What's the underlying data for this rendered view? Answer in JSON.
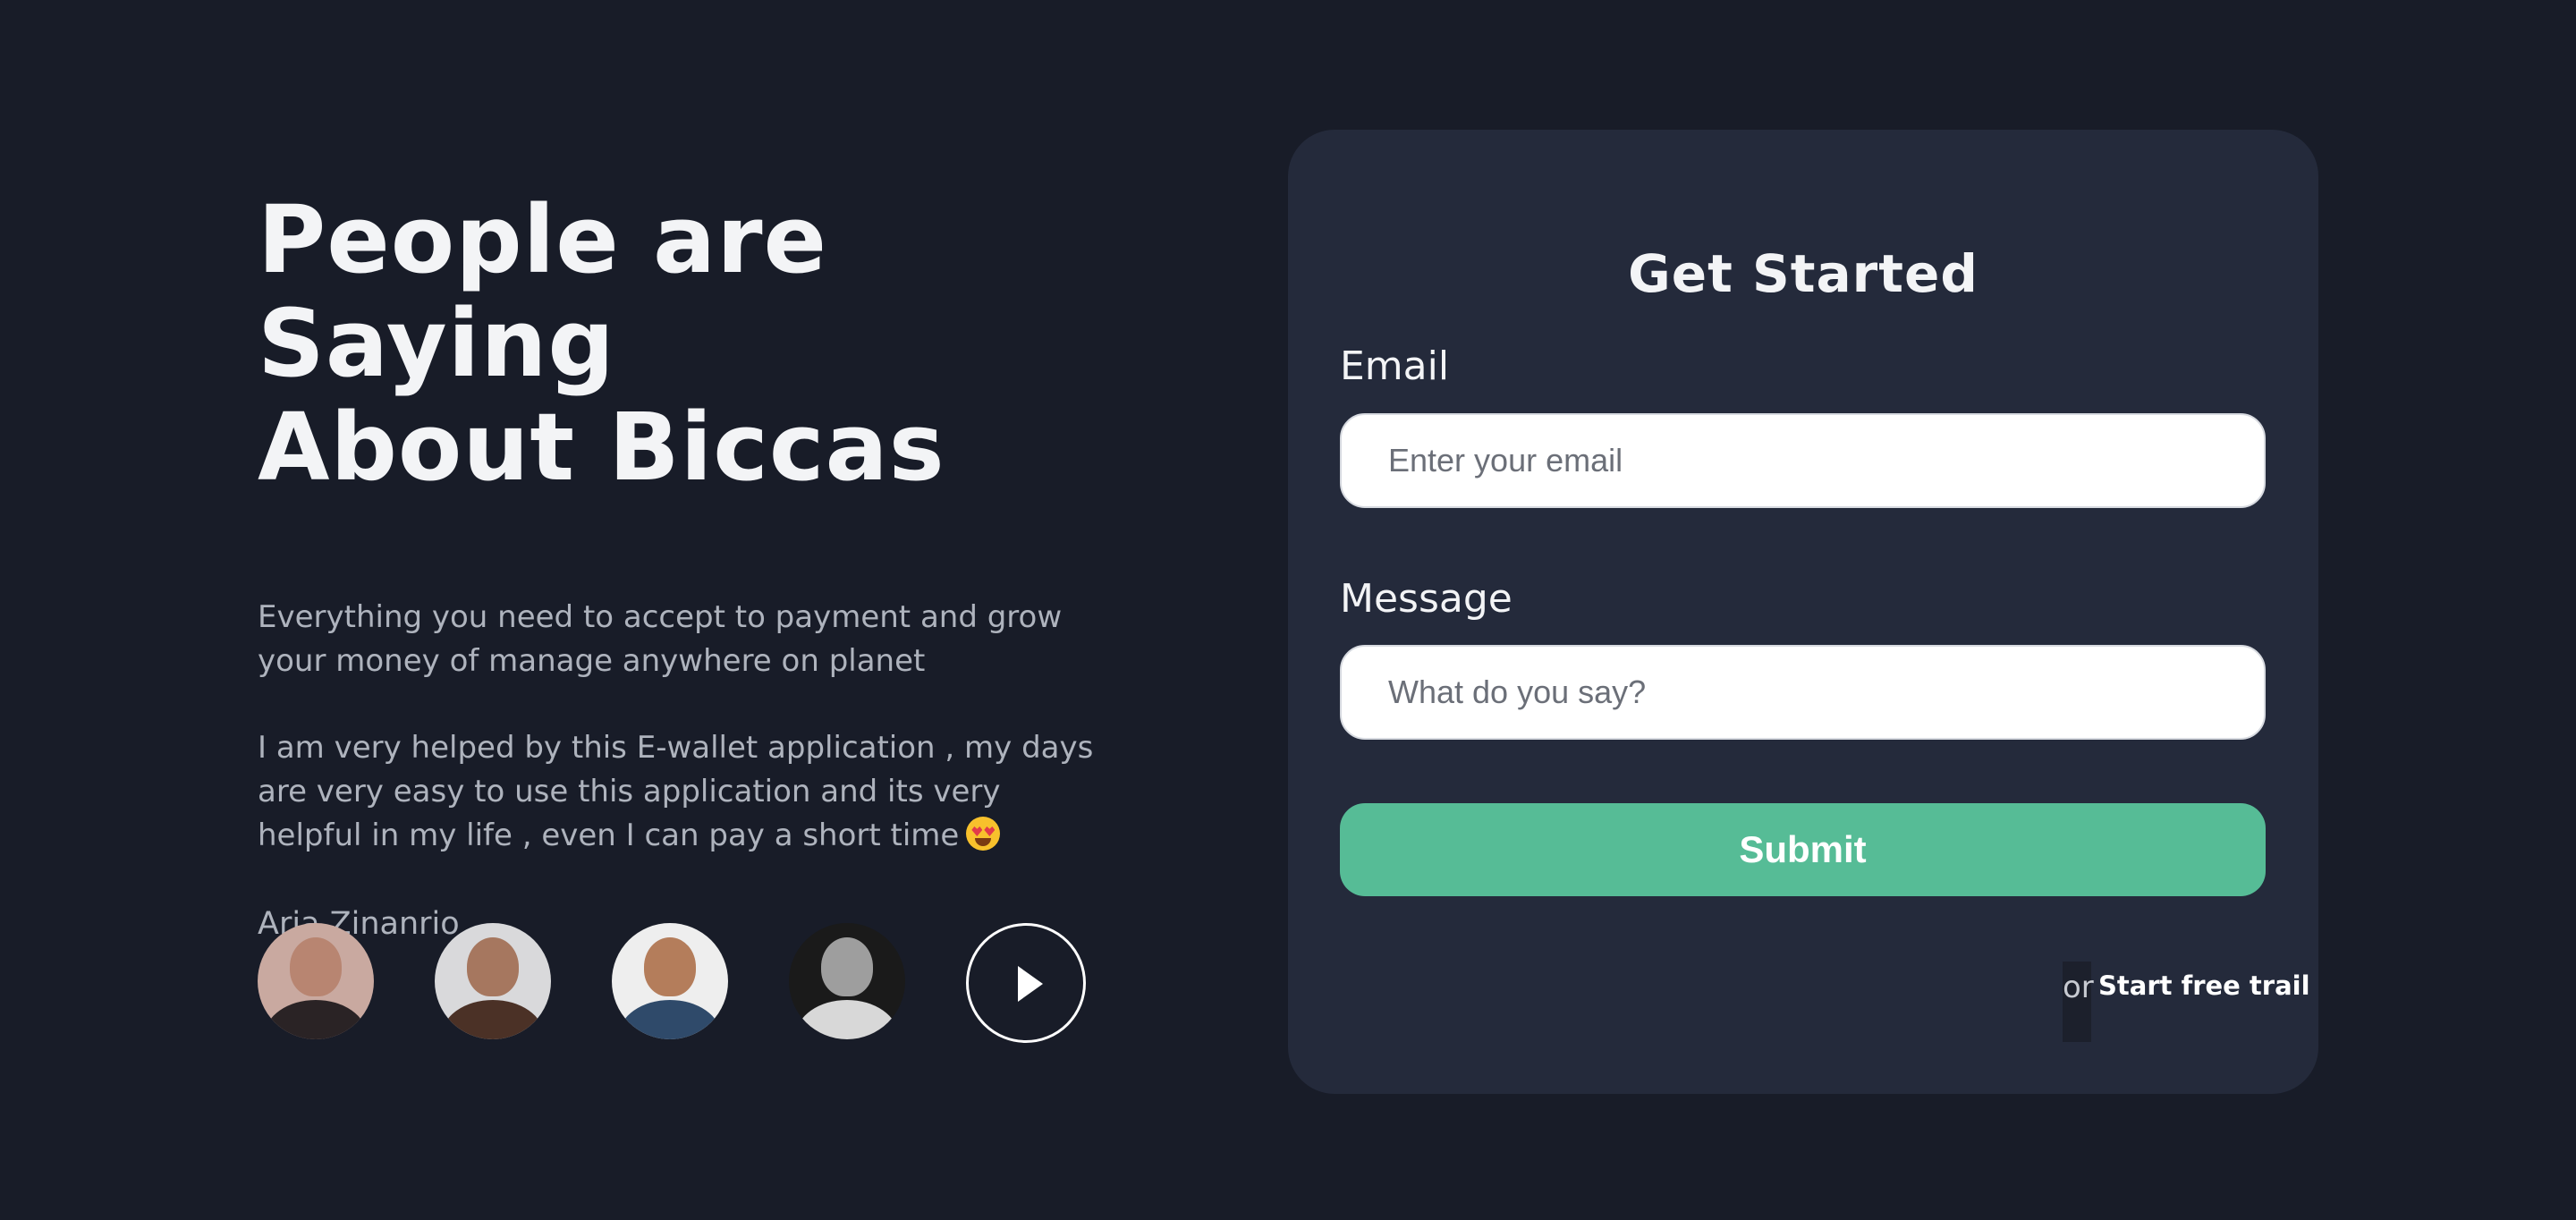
{
  "testimonial": {
    "headline_line1": "People are Saying",
    "headline_line2": "About Biccas",
    "description": "Everything you need to accept to payment and grow your money of manage anywhere on planet",
    "quote": "I am very helped by this E-wallet application , my days are very easy to use this application and its very helpful in my life , even I can pay a short time",
    "quote_emoji": "star-struck-emoji",
    "author": "Aria Zinanrio",
    "avatar_count": 4
  },
  "form": {
    "title": "Get Started",
    "email_label": "Email",
    "email_placeholder": "Enter your email",
    "message_label": "Message",
    "message_placeholder": "What do you say?",
    "submit_label": "Submit",
    "or_text": "or",
    "trial_link": "Start free trail"
  },
  "colors": {
    "background": "#181c28",
    "card": "#242a3b",
    "accent": "#56bc96",
    "text": "#f3f4f6",
    "muted_text": "#aeb3bd"
  },
  "icons": {
    "play": "play-icon",
    "emoji": "star-struck-emoji"
  }
}
